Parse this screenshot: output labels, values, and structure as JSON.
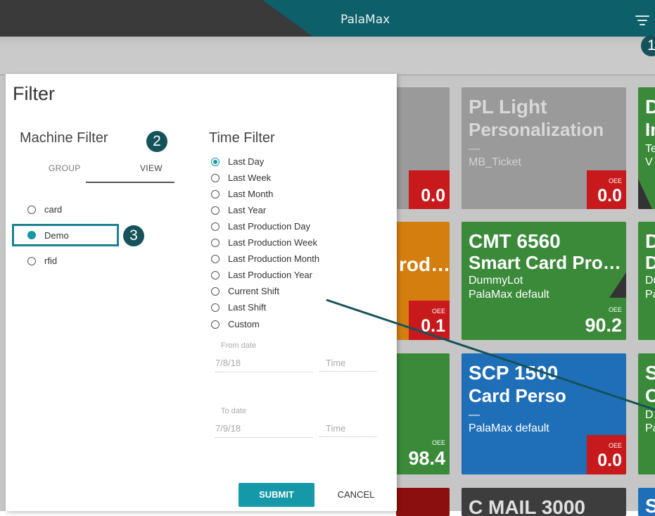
{
  "app": {
    "title": "PalaMax",
    "menu_icon": "filter-menu-icon"
  },
  "tiles": [
    {
      "title_line1": "PL Light",
      "title_line2": "Personalization",
      "line1": "—",
      "line2": "MB_Ticket",
      "oee_label": "OEE",
      "oee_value": "0.0",
      "color": "#9a9a9a"
    },
    {
      "title_line1": "CMT 6560",
      "title_line2": "Smart Card Pro…",
      "line1": "DummyLot",
      "line2": "PalaMax default",
      "oee_label": "OEE",
      "oee_value": "90.2",
      "color": "#3a8a3a"
    },
    {
      "title_line1": "SCP 1500",
      "title_line2": "Card Perso",
      "line1": "—",
      "line2": "PalaMax default",
      "oee_label": "OEE",
      "oee_value": "0.0",
      "color": "#1e6fb8"
    },
    {
      "title_line1": "C MAIL 3000",
      "color": "#3d3d3d"
    },
    {
      "partial_title": "rod…",
      "oee_label": "OEE",
      "oee_value": "0.1",
      "color": "#d47e10"
    },
    {
      "oee_value": "0.0",
      "color": "#9a9a9a"
    },
    {
      "oee_label": "OEE",
      "oee_value": "98.4",
      "color": "#3a8a3a"
    },
    {
      "right_col": [
        {
          "a": "D",
          "b": "Ir",
          "c": "Te",
          "d": "V"
        },
        {
          "a": "D",
          "b": "D",
          "c": "Du",
          "d": "Pa"
        },
        {
          "a": "S",
          "b": "C",
          "c": "D",
          "d": "Pa"
        },
        {
          "a": "S"
        }
      ]
    }
  ],
  "filter": {
    "title": "Filter",
    "machine": {
      "title": "Machine Filter",
      "tabs": [
        "GROUP",
        "VIEW"
      ],
      "items": [
        {
          "label": "card",
          "checked": false
        },
        {
          "label": "Demo",
          "checked": true
        },
        {
          "label": "rfid",
          "checked": false
        }
      ]
    },
    "time": {
      "title": "Time Filter",
      "options": [
        {
          "label": "Last Day",
          "checked": true
        },
        {
          "label": "Last Week",
          "checked": false
        },
        {
          "label": "Last Month",
          "checked": false
        },
        {
          "label": "Last Year",
          "checked": false
        },
        {
          "label": "Last Production Day",
          "checked": false
        },
        {
          "label": "Last Production Week",
          "checked": false
        },
        {
          "label": "Last Production Month",
          "checked": false
        },
        {
          "label": "Last Production Year",
          "checked": false
        },
        {
          "label": "Current Shift",
          "checked": false
        },
        {
          "label": "Last Shift",
          "checked": false
        },
        {
          "label": "Custom",
          "checked": false
        }
      ],
      "from_label": "From date",
      "from_date": "7/8/18",
      "from_time": "Time",
      "to_label": "To date",
      "to_date": "7/9/18",
      "to_time": "Time"
    },
    "submit": "SUBMIT",
    "cancel": "CANCEL"
  },
  "callouts": [
    "1",
    "2",
    "3"
  ],
  "colors": {
    "accent": "#1598a8",
    "header_teal": "#0d6069",
    "callout": "#15525a",
    "oee_red": "#c8191c"
  }
}
